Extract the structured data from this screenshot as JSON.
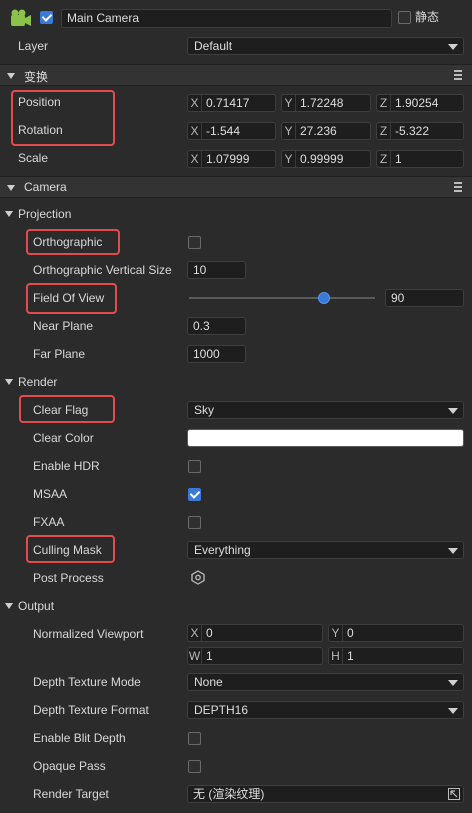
{
  "node": {
    "name": "Main Camera",
    "static_label": "静态",
    "active": true,
    "static": false
  },
  "layer": {
    "label": "Layer",
    "value": "Default"
  },
  "transform": {
    "title": "变换",
    "position": {
      "label": "Position",
      "x": "0.71417",
      "y": "1.72248",
      "z": "1.90254"
    },
    "rotation": {
      "label": "Rotation",
      "x": "-1.544",
      "y": "27.236",
      "z": "-5.322"
    },
    "scale": {
      "label": "Scale",
      "x": "1.07999",
      "y": "0.99999",
      "z": "1"
    },
    "axis_x": "X",
    "axis_y": "Y",
    "axis_z": "Z"
  },
  "camera": {
    "title": "Camera",
    "projection": {
      "title": "Projection",
      "orthographic": {
        "label": "Orthographic",
        "checked": false
      },
      "ortho_size": {
        "label": "Orthographic Vertical Size",
        "value": "10"
      },
      "fov": {
        "label": "Field Of View",
        "value": "90",
        "slider_fraction": 0.73
      },
      "near": {
        "label": "Near Plane",
        "value": "0.3"
      },
      "far": {
        "label": "Far Plane",
        "value": "1000"
      }
    },
    "render": {
      "title": "Render",
      "clear_flag": {
        "label": "Clear Flag",
        "value": "Sky"
      },
      "clear_color": {
        "label": "Clear Color",
        "color": "#ffffff"
      },
      "enable_hdr": {
        "label": "Enable HDR",
        "checked": false
      },
      "msaa": {
        "label": "MSAA",
        "checked": true
      },
      "fxaa": {
        "label": "FXAA",
        "checked": false
      },
      "culling_mask": {
        "label": "Culling Mask",
        "value": "Everything"
      },
      "post_process": {
        "label": "Post Process",
        "icon": "hexagon-gear-icon"
      }
    },
    "output": {
      "title": "Output",
      "viewport": {
        "label": "Normalized Viewport",
        "x": "0",
        "y": "0",
        "w": "1",
        "h": "1",
        "axis_x": "X",
        "axis_y": "Y",
        "axis_w": "W",
        "axis_h": "H"
      },
      "depth_mode": {
        "label": "Depth Texture Mode",
        "value": "None"
      },
      "depth_format": {
        "label": "Depth Texture Format",
        "value": "DEPTH16"
      },
      "blit_depth": {
        "label": "Enable Blit Depth",
        "checked": false
      },
      "opaque_pass": {
        "label": "Opaque Pass",
        "checked": false
      },
      "render_target": {
        "label": "Render Target",
        "value": "无 (渲染纹理)"
      }
    }
  },
  "colors": {
    "highlight": "#e64b4b",
    "accent": "#3a79d6",
    "node_icon": "#8bc34a"
  }
}
